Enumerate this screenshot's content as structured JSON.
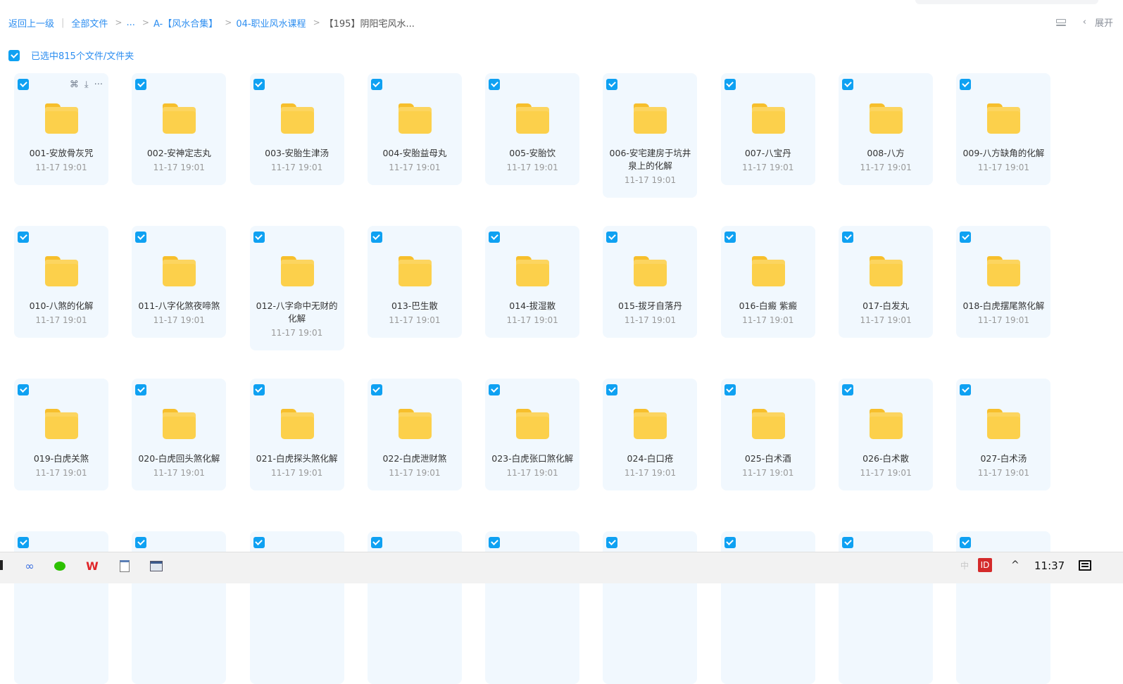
{
  "breadcrumb": {
    "back": "返回上一级",
    "root": "全部文件",
    "ellipsis": "...",
    "level1": "A-【风水合集】",
    "level2": "04-职业风水课程",
    "current": "【195】阴阳宅风水..."
  },
  "header": {
    "expand_label": "展开",
    "collapse_arrow": "‹"
  },
  "selection": {
    "label": "已选中815个文件/文件夹",
    "all_checked": true
  },
  "card_actions": {
    "share": "⌘",
    "download": "⤓",
    "more": "···"
  },
  "files": [
    {
      "name": "001-安放骨灰咒",
      "date": "11-17 19:01"
    },
    {
      "name": "002-安神定志丸",
      "date": "11-17 19:01"
    },
    {
      "name": "003-安胎生津汤",
      "date": "11-17 19:01"
    },
    {
      "name": "004-安胎益母丸",
      "date": "11-17 19:01"
    },
    {
      "name": "005-安胎饮",
      "date": "11-17 19:01"
    },
    {
      "name": "006-安宅建房于坑井泉上的化解",
      "date": "11-17 19:01"
    },
    {
      "name": "007-八宝丹",
      "date": "11-17 19:01"
    },
    {
      "name": "008-八方",
      "date": "11-17 19:01"
    },
    {
      "name": "009-八方缺角的化解",
      "date": "11-17 19:01"
    },
    {
      "name": "010-八煞的化解",
      "date": "11-17 19:01"
    },
    {
      "name": "011-八字化煞夜啼煞",
      "date": "11-17 19:01"
    },
    {
      "name": "012-八字命中无财的化解",
      "date": "11-17 19:01"
    },
    {
      "name": "013-巴生散",
      "date": "11-17 19:01"
    },
    {
      "name": "014-拔湿散",
      "date": "11-17 19:01"
    },
    {
      "name": "015-拔牙自落丹",
      "date": "11-17 19:01"
    },
    {
      "name": "016-白癜 紫癜",
      "date": "11-17 19:01"
    },
    {
      "name": "017-白发丸",
      "date": "11-17 19:01"
    },
    {
      "name": "018-白虎摆尾煞化解",
      "date": "11-17 19:01"
    },
    {
      "name": "019-白虎关煞",
      "date": "11-17 19:01"
    },
    {
      "name": "020-白虎回头煞化解",
      "date": "11-17 19:01"
    },
    {
      "name": "021-白虎探头煞化解",
      "date": "11-17 19:01"
    },
    {
      "name": "022-白虎泄财煞",
      "date": "11-17 19:01"
    },
    {
      "name": "023-白虎张口煞化解",
      "date": "11-17 19:01"
    },
    {
      "name": "024-白口疮",
      "date": "11-17 19:01"
    },
    {
      "name": "025-白术酒",
      "date": "11-17 19:01"
    },
    {
      "name": "026-白术散",
      "date": "11-17 19:01"
    },
    {
      "name": "027-白术汤",
      "date": "11-17 19:01"
    },
    {
      "name": "",
      "date": ""
    },
    {
      "name": "",
      "date": ""
    },
    {
      "name": "",
      "date": ""
    },
    {
      "name": "",
      "date": ""
    },
    {
      "name": "",
      "date": ""
    },
    {
      "name": "",
      "date": ""
    },
    {
      "name": "",
      "date": ""
    },
    {
      "name": "",
      "date": ""
    },
    {
      "name": "",
      "date": ""
    }
  ],
  "taskbar": {
    "wps_label": "W",
    "ime_label": "中",
    "seal_label": "ID",
    "chevron": "^",
    "clock": "11:37"
  },
  "colors": {
    "accent": "#2d8ef0",
    "checkbox": "#0fa1f2",
    "card_bg": "#f1f8fe",
    "folder": "#fcd04b"
  }
}
